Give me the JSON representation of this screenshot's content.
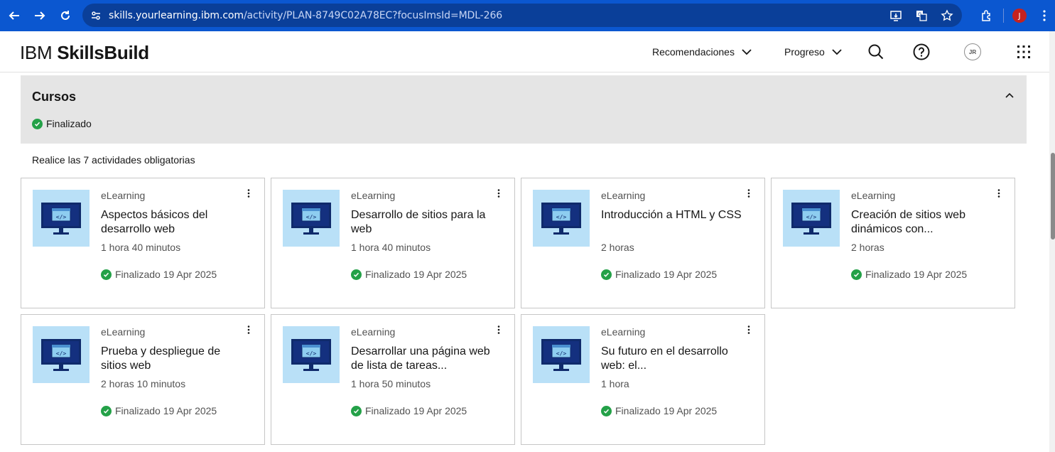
{
  "browser": {
    "url_host": "skills.yourlearning.ibm.com",
    "url_path": "/activity/PLAN-8749C02A78EC?focusImsId=MDL-266",
    "profile_initial": "J"
  },
  "header": {
    "logo_light": "IBM",
    "logo_bold": "SkillsBuild",
    "nav": [
      {
        "label": "Recomendaciones"
      },
      {
        "label": "Progreso"
      }
    ],
    "avatar_initials": "JR"
  },
  "panel": {
    "title": "Cursos",
    "status": "Finalizado"
  },
  "instructions": "Realice las 7 actividades obligatorias",
  "cards": [
    {
      "type": "eLearning",
      "title": "Aspectos básicos del desarrollo web",
      "duration": "1 hora 40 minutos",
      "status": "Finalizado 19 Apr 2025"
    },
    {
      "type": "eLearning",
      "title": "Desarrollo de sitios para la web",
      "duration": "1 hora 40 minutos",
      "status": "Finalizado 19 Apr 2025"
    },
    {
      "type": "eLearning",
      "title": "Introducción a HTML y CSS",
      "duration": "2 horas",
      "status": "Finalizado 19 Apr 2025"
    },
    {
      "type": "eLearning",
      "title": "Creación de sitios web dinámicos con...",
      "duration": "2 horas",
      "status": "Finalizado 19 Apr 2025"
    },
    {
      "type": "eLearning",
      "title": "Prueba y despliegue de sitios web",
      "duration": "2 horas 10 minutos",
      "status": "Finalizado 19 Apr 2025"
    },
    {
      "type": "eLearning",
      "title": "Desarrollar una página web de lista de tareas...",
      "duration": "1 hora 50 minutos",
      "status": "Finalizado 19 Apr 2025"
    },
    {
      "type": "eLearning",
      "title": "Su futuro en el desarrollo web: el...",
      "duration": "1 hora",
      "status": "Finalizado 19 Apr 2025"
    }
  ],
  "colors": {
    "browser_bar": "#0b57d0",
    "success": "#24a148",
    "panel_bg": "#e5e5e5",
    "thumb_bg": "#b9e0f7"
  }
}
